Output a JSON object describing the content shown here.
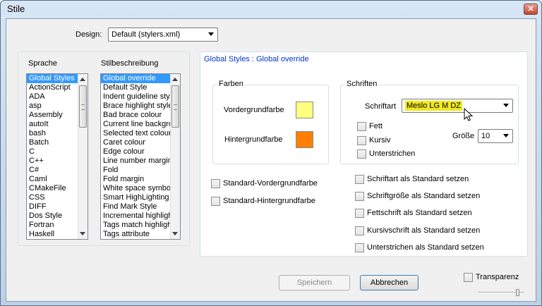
{
  "window": {
    "title": "Stile",
    "close_glyph": "✕"
  },
  "design": {
    "label": "Design:",
    "value": "Default (stylers.xml)"
  },
  "language": {
    "header": "Sprache",
    "items": [
      "Global Styles",
      "ActionScript",
      "ADA",
      "asp",
      "Assembly",
      "autoIt",
      "bash",
      "Batch",
      "C",
      "C++",
      "C#",
      "Caml",
      "CMakeFile",
      "CSS",
      "DIFF",
      "Dos Style",
      "Fortran",
      "Haskell"
    ],
    "selected": 0
  },
  "style": {
    "header": "Stilbeschreibung",
    "items": [
      "Global override",
      "Default Style",
      "Indent guideline style",
      "Brace highlight style",
      "Bad brace colour",
      "Current line background",
      "Selected text colour",
      "Caret colour",
      "Edge colour",
      "Line number margin",
      "Fold",
      "Fold margin",
      "White space symbol",
      "Smart HighLighting",
      "Find Mark Style",
      "Incremental highlight",
      "Tags match highlighting",
      "Tags attribute"
    ],
    "selected": 0
  },
  "detail": {
    "heading": "Global Styles : Global override"
  },
  "colors": {
    "group_title": "Farben",
    "foreground_label": "Vordergrundfarbe",
    "background_label": "Hintergrundfarbe",
    "foreground_color": "#ffff80",
    "background_color": "#ff8000"
  },
  "fonts": {
    "group_title": "Schriften",
    "font_label": "Schriftart",
    "font_value": "Meslo LG M DZ",
    "font_highlight": "#f0e81c",
    "bold_label": "Fett",
    "italic_label": "Kursiv",
    "underline_label": "Unterstrichen",
    "size_label": "Größe",
    "size_value": "10"
  },
  "global_checks": {
    "std_fg": "Standard-Vordergrundfarbe",
    "std_bg": "Standard-Hintergrundfarbe",
    "font_default": "Schriftart als Standard setzen",
    "size_default": "Schriftgröße als Standard setzen",
    "bold_default": "Fettschrift als Standard setzen",
    "italic_default": "Kursivschrift als Standard setzen",
    "underline_default": "Unterstrichen als Standard setzen"
  },
  "buttons": {
    "save": "Speichern",
    "cancel": "Abbrechen"
  },
  "transparency": {
    "label": "Transparenz",
    "level": 0.85
  },
  "icons": {
    "close": "close-icon",
    "cursor": "mouse-pointer-icon"
  }
}
